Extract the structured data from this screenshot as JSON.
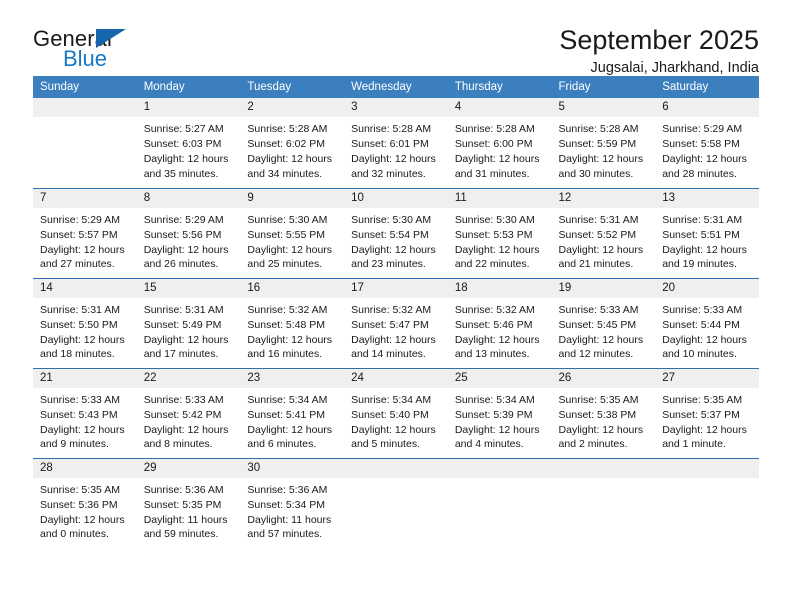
{
  "logo": {
    "word_top": "General",
    "word_bottom": "Blue",
    "triangle_color": "#1665ad",
    "blue_color": "#1878c4"
  },
  "header": {
    "title": "September 2025",
    "subtitle": "Jugsalai, Jharkhand, India"
  },
  "theme": {
    "header_bg": "#3b7fbf",
    "row_divider": "#2f6fae",
    "daynum_bg": "#efefef"
  },
  "calendar": {
    "weekdays": [
      "Sunday",
      "Monday",
      "Tuesday",
      "Wednesday",
      "Thursday",
      "Friday",
      "Saturday"
    ],
    "weeks": [
      [
        {
          "day": "",
          "sunrise": "",
          "sunset": "",
          "daylight1": "",
          "daylight2": ""
        },
        {
          "day": "1",
          "sunrise": "Sunrise: 5:27 AM",
          "sunset": "Sunset: 6:03 PM",
          "daylight1": "Daylight: 12 hours",
          "daylight2": "and 35 minutes."
        },
        {
          "day": "2",
          "sunrise": "Sunrise: 5:28 AM",
          "sunset": "Sunset: 6:02 PM",
          "daylight1": "Daylight: 12 hours",
          "daylight2": "and 34 minutes."
        },
        {
          "day": "3",
          "sunrise": "Sunrise: 5:28 AM",
          "sunset": "Sunset: 6:01 PM",
          "daylight1": "Daylight: 12 hours",
          "daylight2": "and 32 minutes."
        },
        {
          "day": "4",
          "sunrise": "Sunrise: 5:28 AM",
          "sunset": "Sunset: 6:00 PM",
          "daylight1": "Daylight: 12 hours",
          "daylight2": "and 31 minutes."
        },
        {
          "day": "5",
          "sunrise": "Sunrise: 5:28 AM",
          "sunset": "Sunset: 5:59 PM",
          "daylight1": "Daylight: 12 hours",
          "daylight2": "and 30 minutes."
        },
        {
          "day": "6",
          "sunrise": "Sunrise: 5:29 AM",
          "sunset": "Sunset: 5:58 PM",
          "daylight1": "Daylight: 12 hours",
          "daylight2": "and 28 minutes."
        }
      ],
      [
        {
          "day": "7",
          "sunrise": "Sunrise: 5:29 AM",
          "sunset": "Sunset: 5:57 PM",
          "daylight1": "Daylight: 12 hours",
          "daylight2": "and 27 minutes."
        },
        {
          "day": "8",
          "sunrise": "Sunrise: 5:29 AM",
          "sunset": "Sunset: 5:56 PM",
          "daylight1": "Daylight: 12 hours",
          "daylight2": "and 26 minutes."
        },
        {
          "day": "9",
          "sunrise": "Sunrise: 5:30 AM",
          "sunset": "Sunset: 5:55 PM",
          "daylight1": "Daylight: 12 hours",
          "daylight2": "and 25 minutes."
        },
        {
          "day": "10",
          "sunrise": "Sunrise: 5:30 AM",
          "sunset": "Sunset: 5:54 PM",
          "daylight1": "Daylight: 12 hours",
          "daylight2": "and 23 minutes."
        },
        {
          "day": "11",
          "sunrise": "Sunrise: 5:30 AM",
          "sunset": "Sunset: 5:53 PM",
          "daylight1": "Daylight: 12 hours",
          "daylight2": "and 22 minutes."
        },
        {
          "day": "12",
          "sunrise": "Sunrise: 5:31 AM",
          "sunset": "Sunset: 5:52 PM",
          "daylight1": "Daylight: 12 hours",
          "daylight2": "and 21 minutes."
        },
        {
          "day": "13",
          "sunrise": "Sunrise: 5:31 AM",
          "sunset": "Sunset: 5:51 PM",
          "daylight1": "Daylight: 12 hours",
          "daylight2": "and 19 minutes."
        }
      ],
      [
        {
          "day": "14",
          "sunrise": "Sunrise: 5:31 AM",
          "sunset": "Sunset: 5:50 PM",
          "daylight1": "Daylight: 12 hours",
          "daylight2": "and 18 minutes."
        },
        {
          "day": "15",
          "sunrise": "Sunrise: 5:31 AM",
          "sunset": "Sunset: 5:49 PM",
          "daylight1": "Daylight: 12 hours",
          "daylight2": "and 17 minutes."
        },
        {
          "day": "16",
          "sunrise": "Sunrise: 5:32 AM",
          "sunset": "Sunset: 5:48 PM",
          "daylight1": "Daylight: 12 hours",
          "daylight2": "and 16 minutes."
        },
        {
          "day": "17",
          "sunrise": "Sunrise: 5:32 AM",
          "sunset": "Sunset: 5:47 PM",
          "daylight1": "Daylight: 12 hours",
          "daylight2": "and 14 minutes."
        },
        {
          "day": "18",
          "sunrise": "Sunrise: 5:32 AM",
          "sunset": "Sunset: 5:46 PM",
          "daylight1": "Daylight: 12 hours",
          "daylight2": "and 13 minutes."
        },
        {
          "day": "19",
          "sunrise": "Sunrise: 5:33 AM",
          "sunset": "Sunset: 5:45 PM",
          "daylight1": "Daylight: 12 hours",
          "daylight2": "and 12 minutes."
        },
        {
          "day": "20",
          "sunrise": "Sunrise: 5:33 AM",
          "sunset": "Sunset: 5:44 PM",
          "daylight1": "Daylight: 12 hours",
          "daylight2": "and 10 minutes."
        }
      ],
      [
        {
          "day": "21",
          "sunrise": "Sunrise: 5:33 AM",
          "sunset": "Sunset: 5:43 PM",
          "daylight1": "Daylight: 12 hours",
          "daylight2": "and 9 minutes."
        },
        {
          "day": "22",
          "sunrise": "Sunrise: 5:33 AM",
          "sunset": "Sunset: 5:42 PM",
          "daylight1": "Daylight: 12 hours",
          "daylight2": "and 8 minutes."
        },
        {
          "day": "23",
          "sunrise": "Sunrise: 5:34 AM",
          "sunset": "Sunset: 5:41 PM",
          "daylight1": "Daylight: 12 hours",
          "daylight2": "and 6 minutes."
        },
        {
          "day": "24",
          "sunrise": "Sunrise: 5:34 AM",
          "sunset": "Sunset: 5:40 PM",
          "daylight1": "Daylight: 12 hours",
          "daylight2": "and 5 minutes."
        },
        {
          "day": "25",
          "sunrise": "Sunrise: 5:34 AM",
          "sunset": "Sunset: 5:39 PM",
          "daylight1": "Daylight: 12 hours",
          "daylight2": "and 4 minutes."
        },
        {
          "day": "26",
          "sunrise": "Sunrise: 5:35 AM",
          "sunset": "Sunset: 5:38 PM",
          "daylight1": "Daylight: 12 hours",
          "daylight2": "and 2 minutes."
        },
        {
          "day": "27",
          "sunrise": "Sunrise: 5:35 AM",
          "sunset": "Sunset: 5:37 PM",
          "daylight1": "Daylight: 12 hours",
          "daylight2": "and 1 minute."
        }
      ],
      [
        {
          "day": "28",
          "sunrise": "Sunrise: 5:35 AM",
          "sunset": "Sunset: 5:36 PM",
          "daylight1": "Daylight: 12 hours",
          "daylight2": "and 0 minutes."
        },
        {
          "day": "29",
          "sunrise": "Sunrise: 5:36 AM",
          "sunset": "Sunset: 5:35 PM",
          "daylight1": "Daylight: 11 hours",
          "daylight2": "and 59 minutes."
        },
        {
          "day": "30",
          "sunrise": "Sunrise: 5:36 AM",
          "sunset": "Sunset: 5:34 PM",
          "daylight1": "Daylight: 11 hours",
          "daylight2": "and 57 minutes."
        },
        {
          "day": "",
          "sunrise": "",
          "sunset": "",
          "daylight1": "",
          "daylight2": ""
        },
        {
          "day": "",
          "sunrise": "",
          "sunset": "",
          "daylight1": "",
          "daylight2": ""
        },
        {
          "day": "",
          "sunrise": "",
          "sunset": "",
          "daylight1": "",
          "daylight2": ""
        },
        {
          "day": "",
          "sunrise": "",
          "sunset": "",
          "daylight1": "",
          "daylight2": ""
        }
      ]
    ]
  }
}
